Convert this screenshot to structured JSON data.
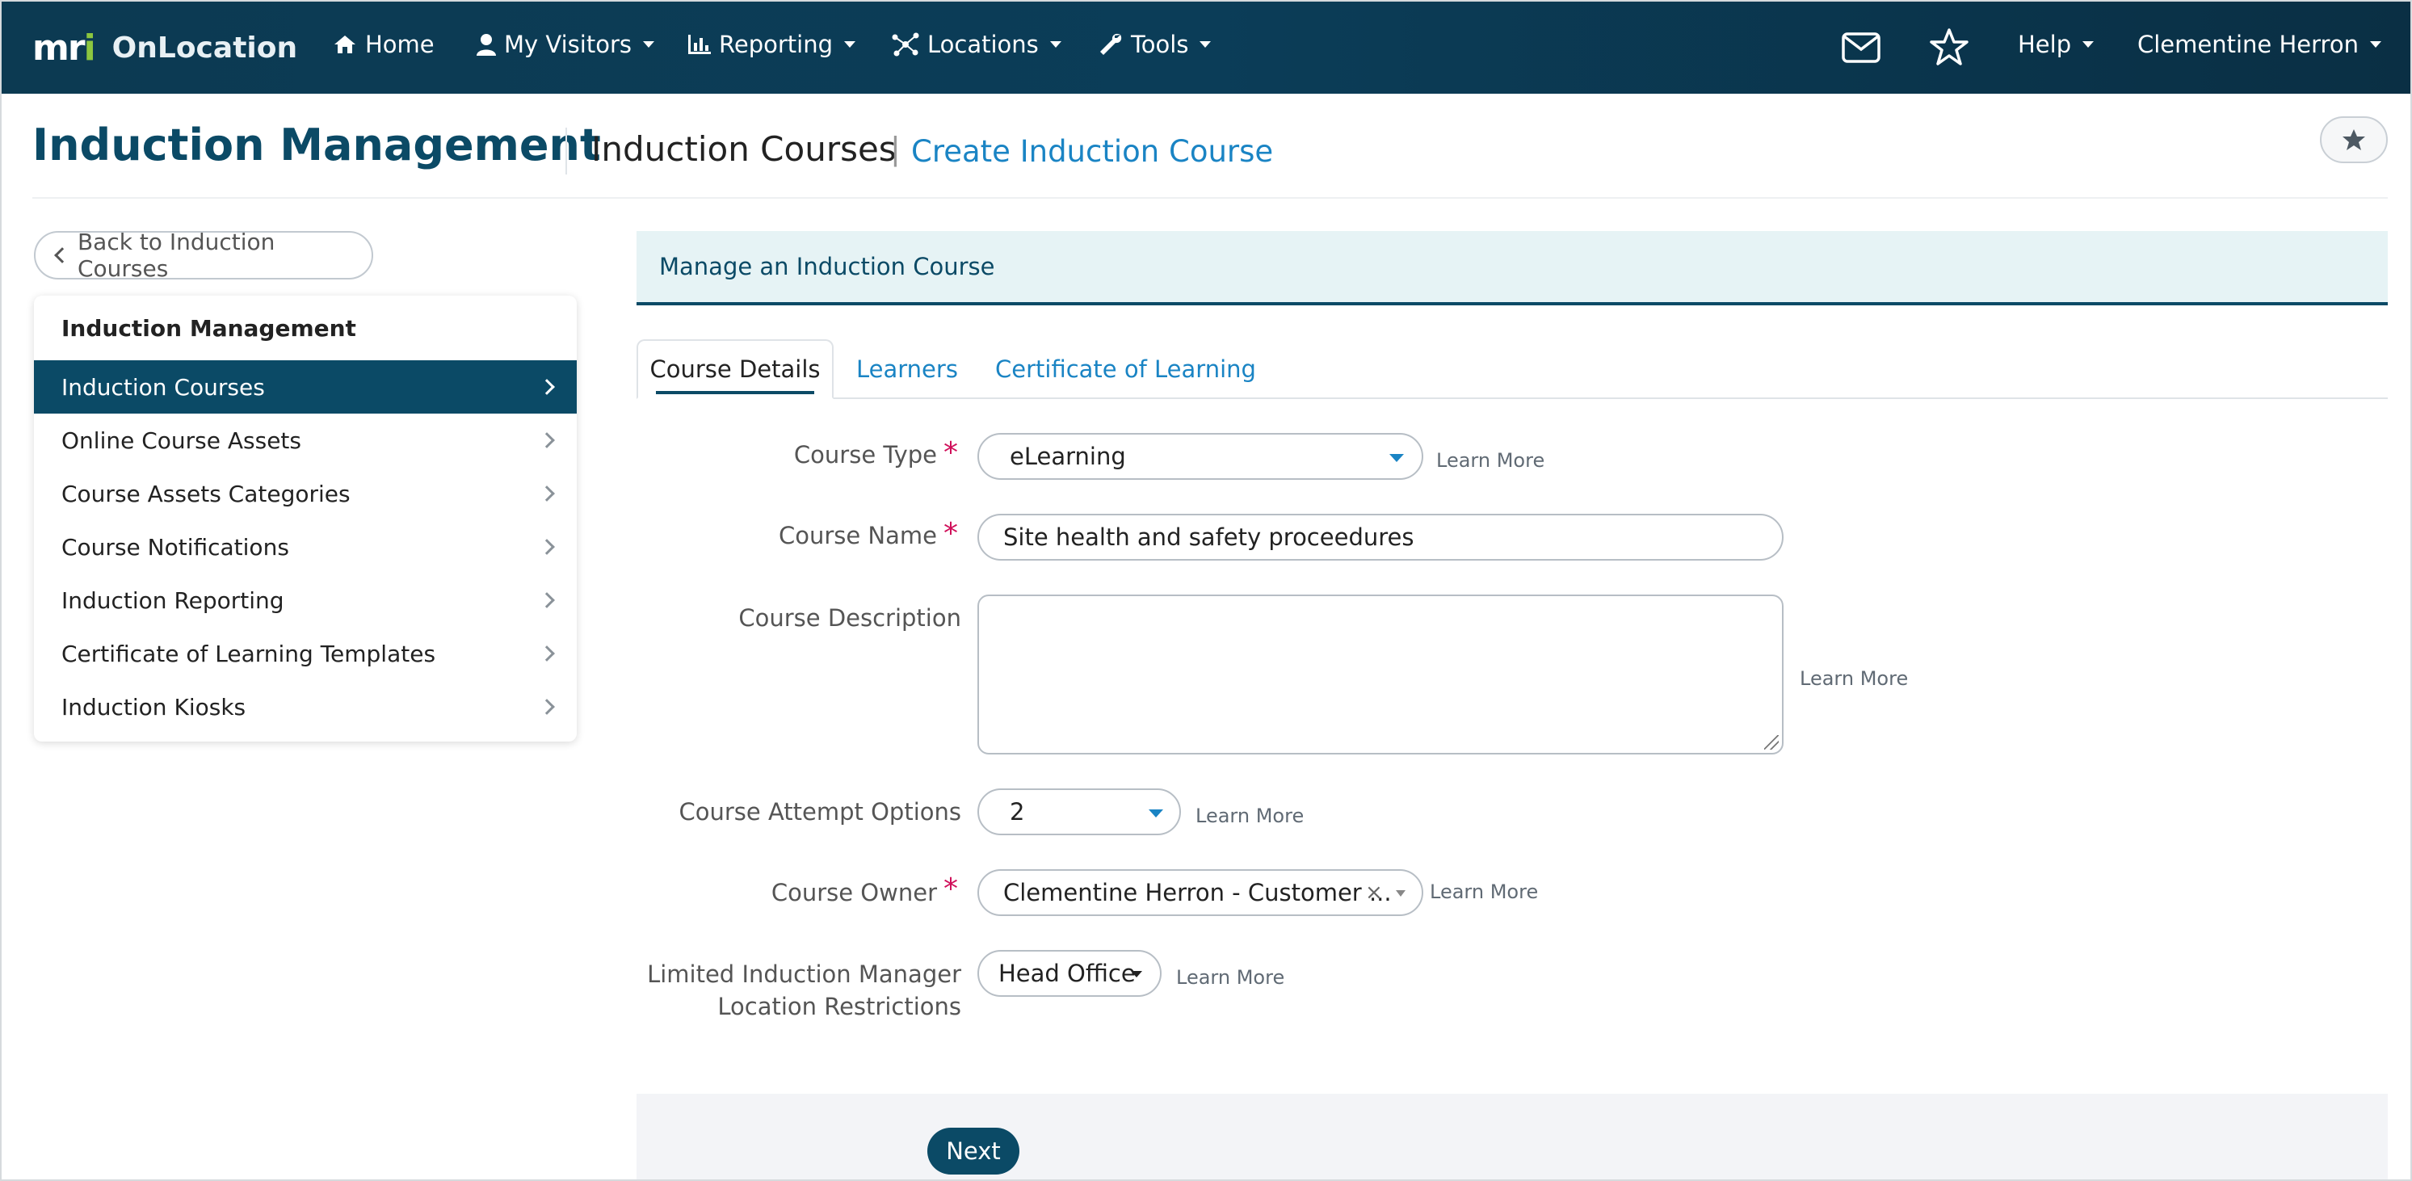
{
  "app": {
    "logo_text": "mri",
    "name": "OnLocation"
  },
  "nav": {
    "home": "Home",
    "visitors": "My Visitors",
    "reporting": "Reporting",
    "locations": "Locations",
    "tools": "Tools",
    "help": "Help",
    "user": "Clementine Herron"
  },
  "header": {
    "title": "Induction Management",
    "section": "Induction Courses",
    "separator": "|",
    "action_link": "Create Induction Course"
  },
  "sidebar": {
    "back_label": "Back to Induction Courses",
    "heading": "Induction Management",
    "items": [
      {
        "label": "Induction Courses",
        "active": true
      },
      {
        "label": "Online Course Assets"
      },
      {
        "label": "Course Assets Categories"
      },
      {
        "label": "Course Notifications"
      },
      {
        "label": "Induction Reporting"
      },
      {
        "label": "Certificate of Learning Templates"
      },
      {
        "label": "Induction Kiosks"
      }
    ]
  },
  "panel": {
    "heading": "Manage an Induction Course",
    "tabs": [
      "Course Details",
      "Learners",
      "Certificate of Learning"
    ]
  },
  "form": {
    "learn_more": "Learn More",
    "required_mark": "*",
    "course_type": {
      "label": "Course Type",
      "value": "eLearning"
    },
    "course_name": {
      "label": "Course Name",
      "value": "Site health and safety proceedures"
    },
    "course_description": {
      "label": "Course Description",
      "value": ""
    },
    "attempt_options": {
      "label": "Course Attempt Options",
      "value": "2"
    },
    "course_owner": {
      "label": "Course Owner",
      "value": "Clementine Herron - Customer ...",
      "clear": "×"
    },
    "location_restrictions": {
      "label_line1": "Limited Induction Manager",
      "label_line2": "Location Restrictions",
      "value": "Head Office"
    }
  },
  "footer": {
    "next_label": "Next"
  },
  "colors": {
    "brand_dark": "#0b4a66",
    "link_blue": "#1a84c4",
    "required": "#d0105a",
    "logo_accent": "#8cc63f"
  }
}
